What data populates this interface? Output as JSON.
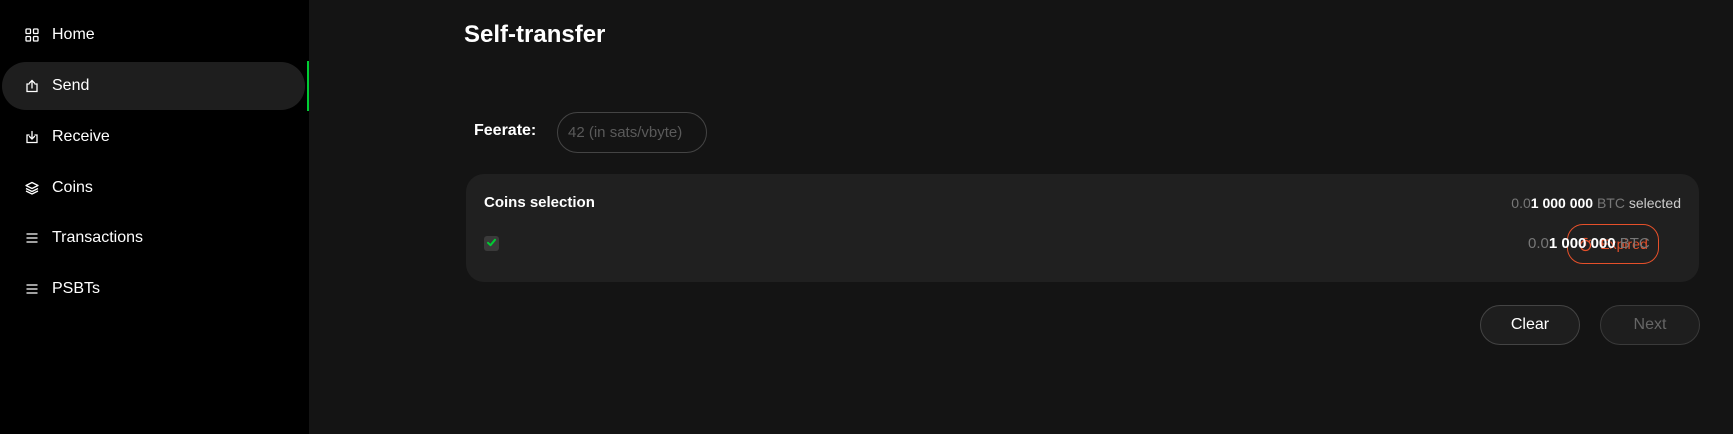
{
  "sidebar": {
    "items": [
      {
        "label": "Home",
        "icon": "home-grid-icon"
      },
      {
        "label": "Send",
        "icon": "send-icon",
        "active": true
      },
      {
        "label": "Receive",
        "icon": "receive-icon"
      },
      {
        "label": "Coins",
        "icon": "coins-layers-icon"
      },
      {
        "label": "Transactions",
        "icon": "list-icon"
      },
      {
        "label": "PSBTs",
        "icon": "list-icon"
      }
    ],
    "active_color": "#00cc33"
  },
  "main": {
    "title": "Self-transfer",
    "feerate": {
      "label": "Feerate:",
      "placeholder": "42 (in sats/vbyte)",
      "value": ""
    },
    "coins_selection": {
      "title": "Coins selection",
      "summary": {
        "amount_prefix": "0.0",
        "amount_main": "1 000 000",
        "unit": "BTC",
        "suffix": "selected"
      },
      "coins": [
        {
          "checked": true,
          "status": "Expired",
          "amount_prefix": "0.0",
          "amount_main": "1 000 000",
          "unit": "BTC"
        }
      ]
    },
    "buttons": {
      "clear": "Clear",
      "next": "Next"
    }
  },
  "colors": {
    "accent_green": "#00cc33",
    "expired_orange": "#e5502a"
  }
}
